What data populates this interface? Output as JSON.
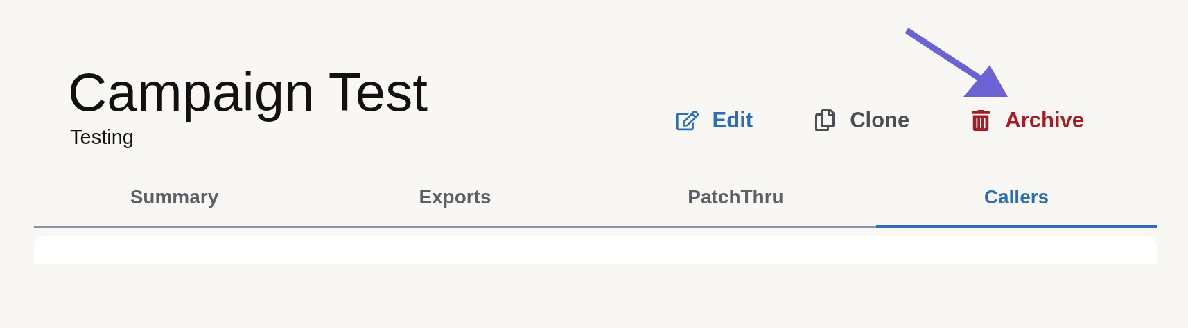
{
  "header": {
    "title": "Campaign Test",
    "subtitle": "Testing"
  },
  "actions": [
    {
      "kind": "edit",
      "label": "Edit"
    },
    {
      "kind": "clone",
      "label": "Clone"
    },
    {
      "kind": "archive",
      "label": "Archive"
    }
  ],
  "tabs": [
    {
      "label": "Summary",
      "selected": false
    },
    {
      "label": "Exports",
      "selected": false
    },
    {
      "label": "PatchThru",
      "selected": false
    },
    {
      "label": "Callers",
      "selected": true
    }
  ]
}
